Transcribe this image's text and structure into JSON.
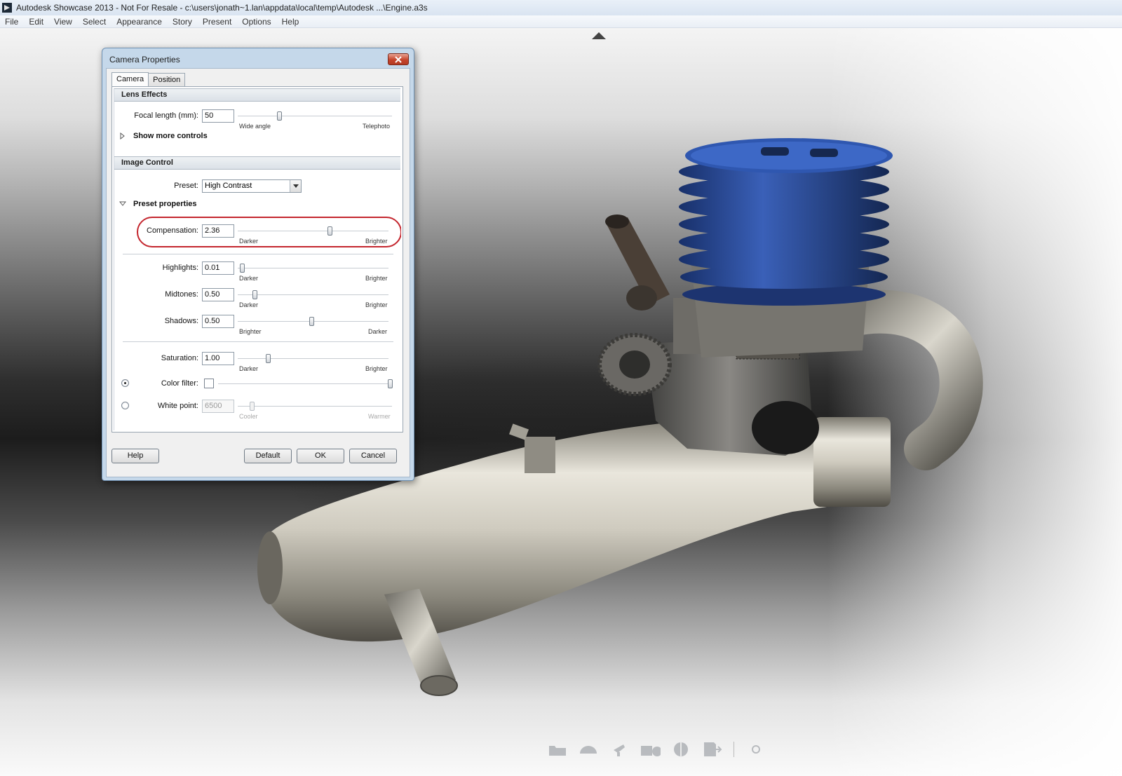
{
  "window": {
    "title": "Autodesk Showcase 2013 - Not For Resale - c:\\users\\jonath~1.lan\\appdata\\local\\temp\\Autodesk ...\\Engine.a3s"
  },
  "menu": [
    "File",
    "Edit",
    "View",
    "Select",
    "Appearance",
    "Story",
    "Present",
    "Options",
    "Help"
  ],
  "dialog": {
    "title": "Camera Properties",
    "tabs": [
      "Camera",
      "Position"
    ],
    "active_tab": "Camera",
    "lens_effects": {
      "header": "Lens Effects",
      "focal_label": "Focal length (mm):",
      "focal_value": "50",
      "focal_slider_fraction": 0.27,
      "left_caption": "Wide angle",
      "right_caption": "Telephoto",
      "more_controls": "Show more controls"
    },
    "image_control": {
      "header": "Image Control",
      "preset_label": "Preset:",
      "preset_value": "High Contrast",
      "preset_props": "Preset properties",
      "compensation": {
        "label": "Compensation:",
        "value": "2.36",
        "left": "Darker",
        "right": "Brighter",
        "fraction": 0.61
      },
      "highlights": {
        "label": "Highlights:",
        "value": "0.01",
        "left": "Darker",
        "right": "Brighter",
        "fraction": 0.03
      },
      "midtones": {
        "label": "Midtones:",
        "value": "0.50",
        "left": "Darker",
        "right": "Brighter",
        "fraction": 0.11
      },
      "shadows": {
        "label": "Shadows:",
        "value": "0.50",
        "left": "Brighter",
        "right": "Dark​er",
        "fraction": 0.49
      },
      "saturation": {
        "label": "Saturation:",
        "value": "1.00",
        "left": "Darker",
        "right": "Brighter",
        "fraction": 0.2
      },
      "color_filter": {
        "label": "Color filter:",
        "selected": true,
        "fraction": 1.0
      },
      "white_point": {
        "label": "White point:",
        "value": "6500",
        "left": "Cooler",
        "right": "Warmer",
        "selected": false,
        "fraction": 0.09
      }
    },
    "buttons": {
      "help": "Help",
      "default": "Default",
      "ok": "OK",
      "cancel": "Cancel"
    }
  },
  "toolbar_icons": [
    "folder-icon",
    "environment-icon",
    "lights-icon",
    "camera-icon",
    "materials-icon",
    "presentation-icon",
    "tools-icon"
  ],
  "colors": {
    "accent_highlight": "#c4262e",
    "cylinder_head": "#2b4f9e",
    "dialog_frame": "#c5d8ea"
  }
}
